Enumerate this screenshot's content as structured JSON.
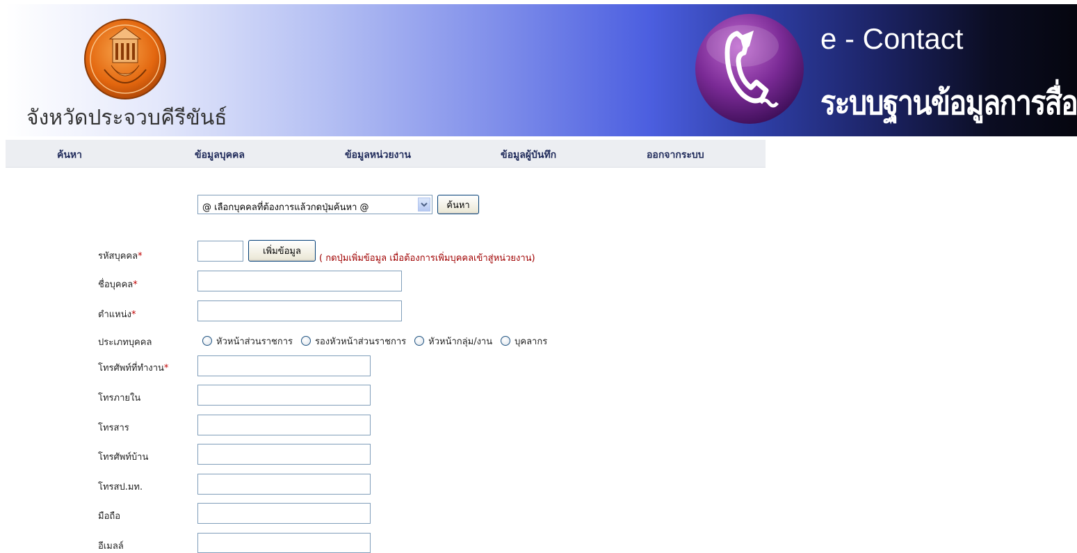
{
  "header": {
    "province_name": "จังหวัดประจวบคีรีขันธ์",
    "app_title": "e - Contact",
    "app_subtitle": "ระบบฐานข้อมูลการสื่อสาร"
  },
  "nav": {
    "items": [
      {
        "label": "ค้นหา"
      },
      {
        "label": "ข้อมูลบุคคล"
      },
      {
        "label": "ข้อมูลหน่วยงาน"
      },
      {
        "label": "ข้อมูลผู้บันทึก"
      },
      {
        "label": "ออกจากระบบ"
      }
    ]
  },
  "search": {
    "select_value": "@ เลือกบุคคลที่ต้องการแล้วกดปุ่มค้นหา @",
    "search_button": "ค้นหา"
  },
  "form": {
    "person_code_label": "รหัสบุคคล",
    "add_button": "เพิ่มข้อมูล",
    "add_hint": "( กดปุ่มเพิ่มข้อมูล เมื่อต้องการเพิ่มบุคคลเข้าสู่หน่วยงาน)",
    "name_label": "ชื่อบุคคล",
    "position_label": "ตำแหน่ง",
    "type_label": "ประเภทบุคคล",
    "type_options": [
      "หัวหน้าส่วนราชการ",
      "รองหัวหน้าส่วนราชการ",
      "หัวหน้ากลุ่ม/งาน",
      "บุคลากร"
    ],
    "office_phone_label": "โทรศัพท์ที่ทำงาน",
    "internal_phone_label": "โทรภายใน",
    "fax_label": "โทรสาร",
    "home_phone_label": "โทรศัพท์บ้าน",
    "interior_phone_label": "โทรสป.มท.",
    "mobile_label": "มือถือ",
    "email_label": "อีเมลล์",
    "required_mark": "*"
  },
  "colors": {
    "nav_text": "#1f2a5a",
    "required": "#c00000",
    "hint": "#a00000",
    "input_border": "#7f9db9"
  }
}
